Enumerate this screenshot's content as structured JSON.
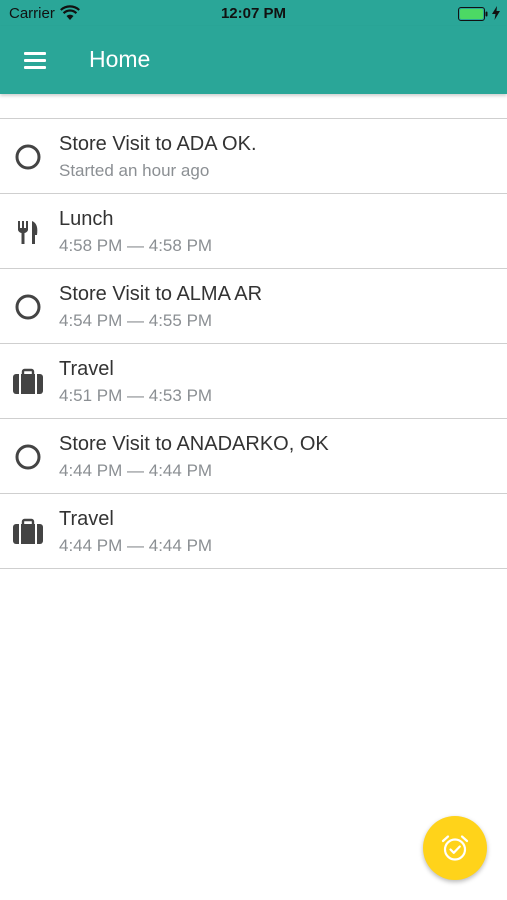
{
  "status_bar": {
    "carrier": "Carrier",
    "time": "12:07 PM"
  },
  "app_bar": {
    "title": "Home",
    "menu_icon": "hamburger-menu-icon"
  },
  "entries": [
    {
      "icon": "circle-outline-icon",
      "title": "Store Visit to ADA OK.",
      "subtitle": "Started an hour ago"
    },
    {
      "icon": "fork-knife-icon",
      "title": "Lunch",
      "subtitle": "4:58 PM — 4:58 PM"
    },
    {
      "icon": "circle-outline-icon",
      "title": "Store Visit to ALMA AR",
      "subtitle": "4:54 PM — 4:55 PM"
    },
    {
      "icon": "briefcase-icon",
      "title": "Travel",
      "subtitle": "4:51 PM — 4:53 PM"
    },
    {
      "icon": "circle-outline-icon",
      "title": "Store Visit to ANADARKO, OK",
      "subtitle": "4:44 PM — 4:44 PM"
    },
    {
      "icon": "briefcase-icon",
      "title": "Travel",
      "subtitle": "4:44 PM — 4:44 PM"
    }
  ],
  "fab": {
    "icon": "alarm-check-icon"
  },
  "colors": {
    "primary": "#2aa698",
    "accent": "#ffd31a",
    "icon": "#444444",
    "subtitle": "#8b8f93"
  }
}
